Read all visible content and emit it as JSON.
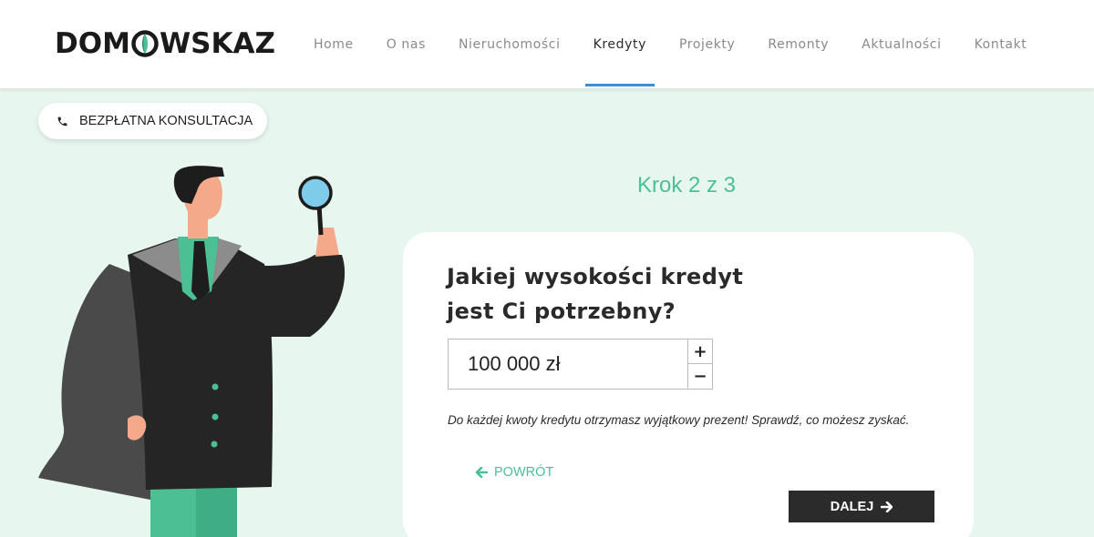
{
  "brand": {
    "logo_left": "DOM",
    "logo_right": "WSKAZ",
    "accent": "#4cbf95",
    "dark": "#2b2b2b",
    "nav_underline": "#3e8fd6",
    "background": "#e8f6f0"
  },
  "nav": {
    "items": [
      {
        "label": "Home",
        "active": false
      },
      {
        "label": "O nas",
        "active": false
      },
      {
        "label": "Nieruchomości",
        "active": false
      },
      {
        "label": "Kredyty",
        "active": true
      },
      {
        "label": "Projekty",
        "active": false
      },
      {
        "label": "Remonty",
        "active": false
      },
      {
        "label": "Aktualności",
        "active": false
      },
      {
        "label": "Kontakt",
        "active": false
      }
    ]
  },
  "consult": {
    "label": "BEZPŁATNA KONSULTACJA",
    "icon": "phone-icon"
  },
  "form": {
    "step": "Krok 2 z 3",
    "question_line1": "Jakiej wysokości kredyt",
    "question_line2": "jest Ci potrzebny?",
    "amount": "100 000 zł",
    "plus": "+",
    "minus": "−",
    "note": "Do każdej kwoty kredytu otrzymasz wyjątkowy prezent! Sprawdź, co możesz zyskać.",
    "back_label": "POWRÓT",
    "next_label": "DALEJ"
  }
}
